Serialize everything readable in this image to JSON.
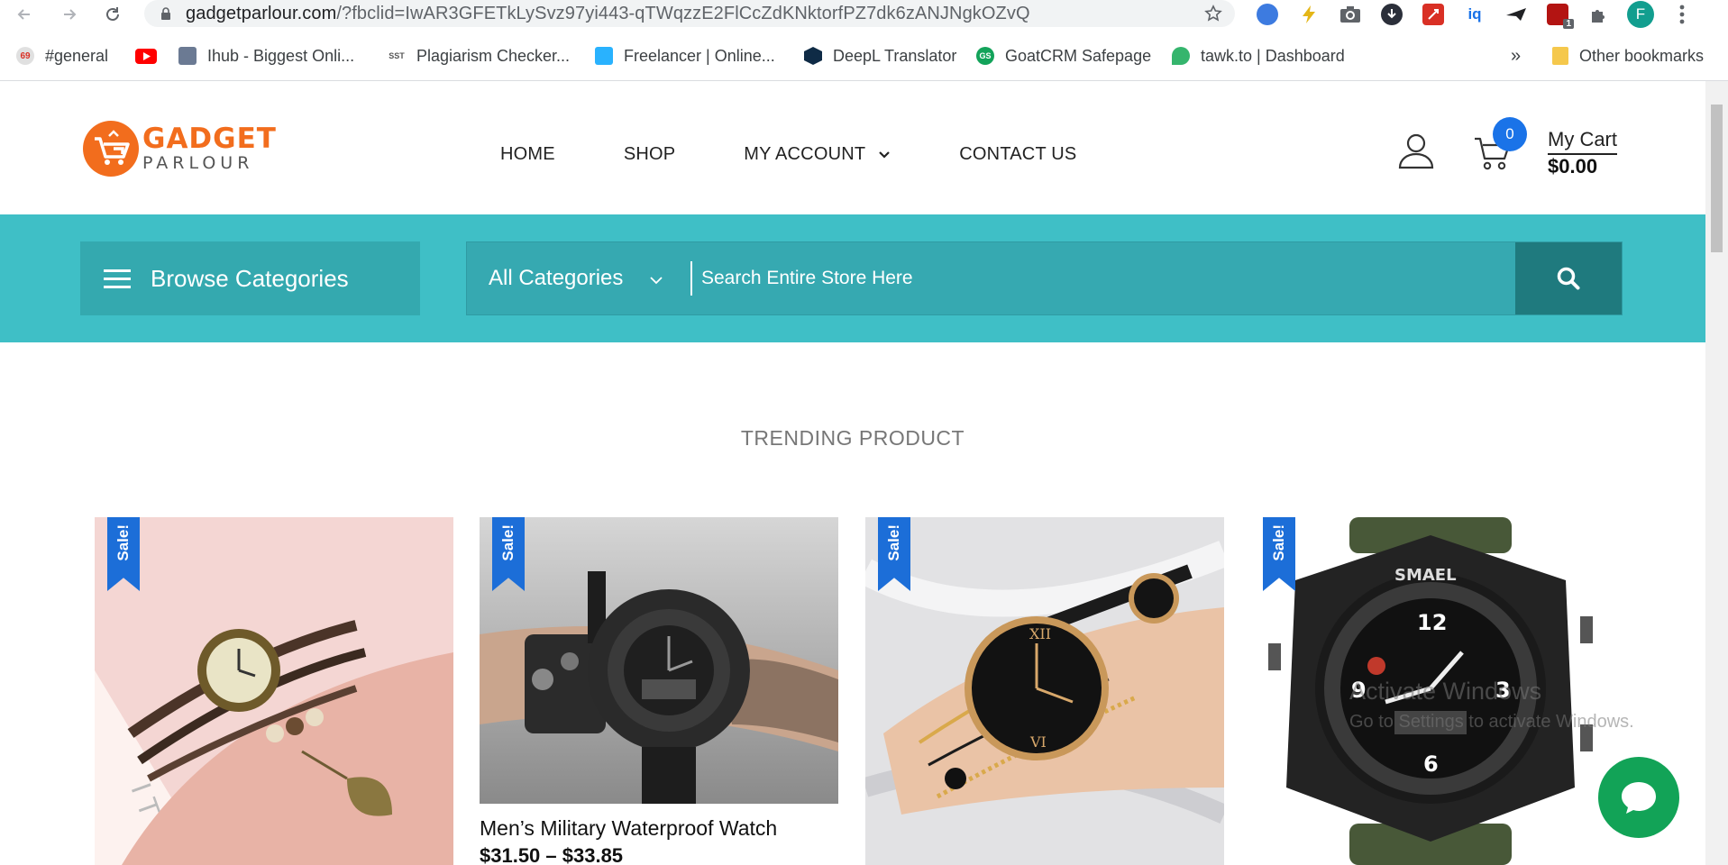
{
  "browser": {
    "url_domain": "gadgetparlour.com",
    "url_path": "/?fbclid=IwAR3GFETkLySvz97yi443-qTWqzzE2FlCcZdKNktorfPZ7dk6zANJNgkOZvQ",
    "profile_initial": "F",
    "extensions": [
      "iq",
      "1"
    ],
    "bookmarks": [
      {
        "label": "#general",
        "icon": "slack-icon"
      },
      {
        "label": "",
        "icon": "youtube-icon"
      },
      {
        "label": "Ihub - Biggest Onli...",
        "icon": "ihub-icon"
      },
      {
        "label": "Plagiarism Checker...",
        "icon": "sst-icon"
      },
      {
        "label": "Freelancer | Online...",
        "icon": "freelancer-icon"
      },
      {
        "label": "DeepL Translator",
        "icon": "deepl-icon"
      },
      {
        "label": "GoatCRM Safepage",
        "icon": "goatcrm-icon"
      },
      {
        "label": "tawk.to | Dashboard",
        "icon": "tawk-icon"
      }
    ],
    "more": "»",
    "other_bookmarks": "Other bookmarks"
  },
  "header": {
    "logo_line1": "GADGET",
    "logo_line2": "PARLOUR",
    "nav": [
      "HOME",
      "SHOP",
      "MY ACCOUNT",
      "CONTACT US"
    ],
    "cart_count": "0",
    "cart_label": "My Cart",
    "cart_total": "$0.00"
  },
  "search": {
    "browse_label": "Browse Categories",
    "category_value": "All Categories",
    "placeholder": "Search Entire Store Here"
  },
  "trending": {
    "title": "TRENDING PRODUCT",
    "sale_badge": "Sale!",
    "products": [
      {
        "image": "leather-bracelet-watch"
      },
      {
        "image": "mens-military-watch",
        "name": "Men’s Military Waterproof Watch",
        "price": "$31.50 – $33.85"
      },
      {
        "image": "ladies-bracelet-watch-set"
      },
      {
        "image": "smael-sport-watch"
      }
    ]
  },
  "overlay": {
    "watermark_line1": "Activate Windows",
    "watermark_line2": "Go to Settings to activate Windows."
  },
  "colors": {
    "teal": "#3fbfc6",
    "teal_dark": "#34a9af",
    "search_button": "#1f7a7e",
    "brand_orange": "#f26d1d",
    "sale_blue": "#1c6ed8",
    "chat_green": "#12a357"
  }
}
